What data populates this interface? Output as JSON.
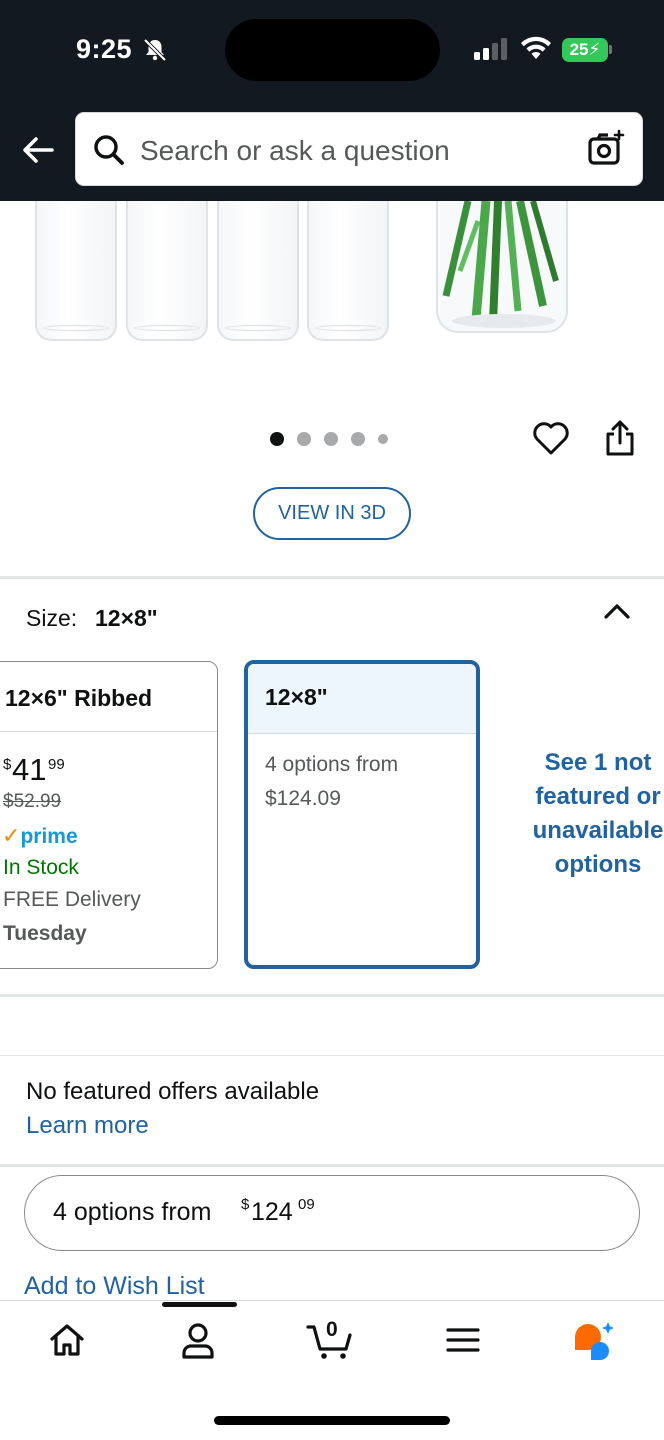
{
  "status_bar": {
    "time": "9:25",
    "battery": "25"
  },
  "search": {
    "placeholder": "Search or ask a question"
  },
  "product_view": {
    "view_3d_label": "VIEW IN 3D",
    "image_count": 5,
    "active_image": 1
  },
  "size": {
    "label": "Size:",
    "selected": "12×8\""
  },
  "size_options": [
    {
      "name": "12×6\" Ribbed",
      "price_symbol": "$",
      "price_whole": "41",
      "price_fraction": "99",
      "list_price": "$52.99",
      "prime": "prime",
      "stock": "In Stock",
      "delivery": "FREE Delivery",
      "delivery_day": "Tuesday"
    },
    {
      "name": "12×8\"",
      "options_line1": "4 options from",
      "options_line2": "$124.09"
    }
  ],
  "see_more": {
    "line1": "See 1 not",
    "line2": "featured or",
    "line3": "unavailable",
    "line4": "options"
  },
  "offers": {
    "message": "No featured offers available",
    "learn_more": "Learn more"
  },
  "options_button": {
    "label": "4 options from",
    "symbol": "$",
    "whole": "124",
    "fraction": "09"
  },
  "wishlist_label": "Add to Wish List",
  "bottom_nav": {
    "cart_count": "0",
    "items": [
      "home-icon",
      "account-icon",
      "cart-icon",
      "menu-icon",
      "rufus-icon"
    ]
  },
  "colors": {
    "header_bg": "#131921",
    "link": "#2162a1",
    "in_stock": "#007600",
    "prime": "#1399d6",
    "selected_bg": "#edf6fd"
  }
}
